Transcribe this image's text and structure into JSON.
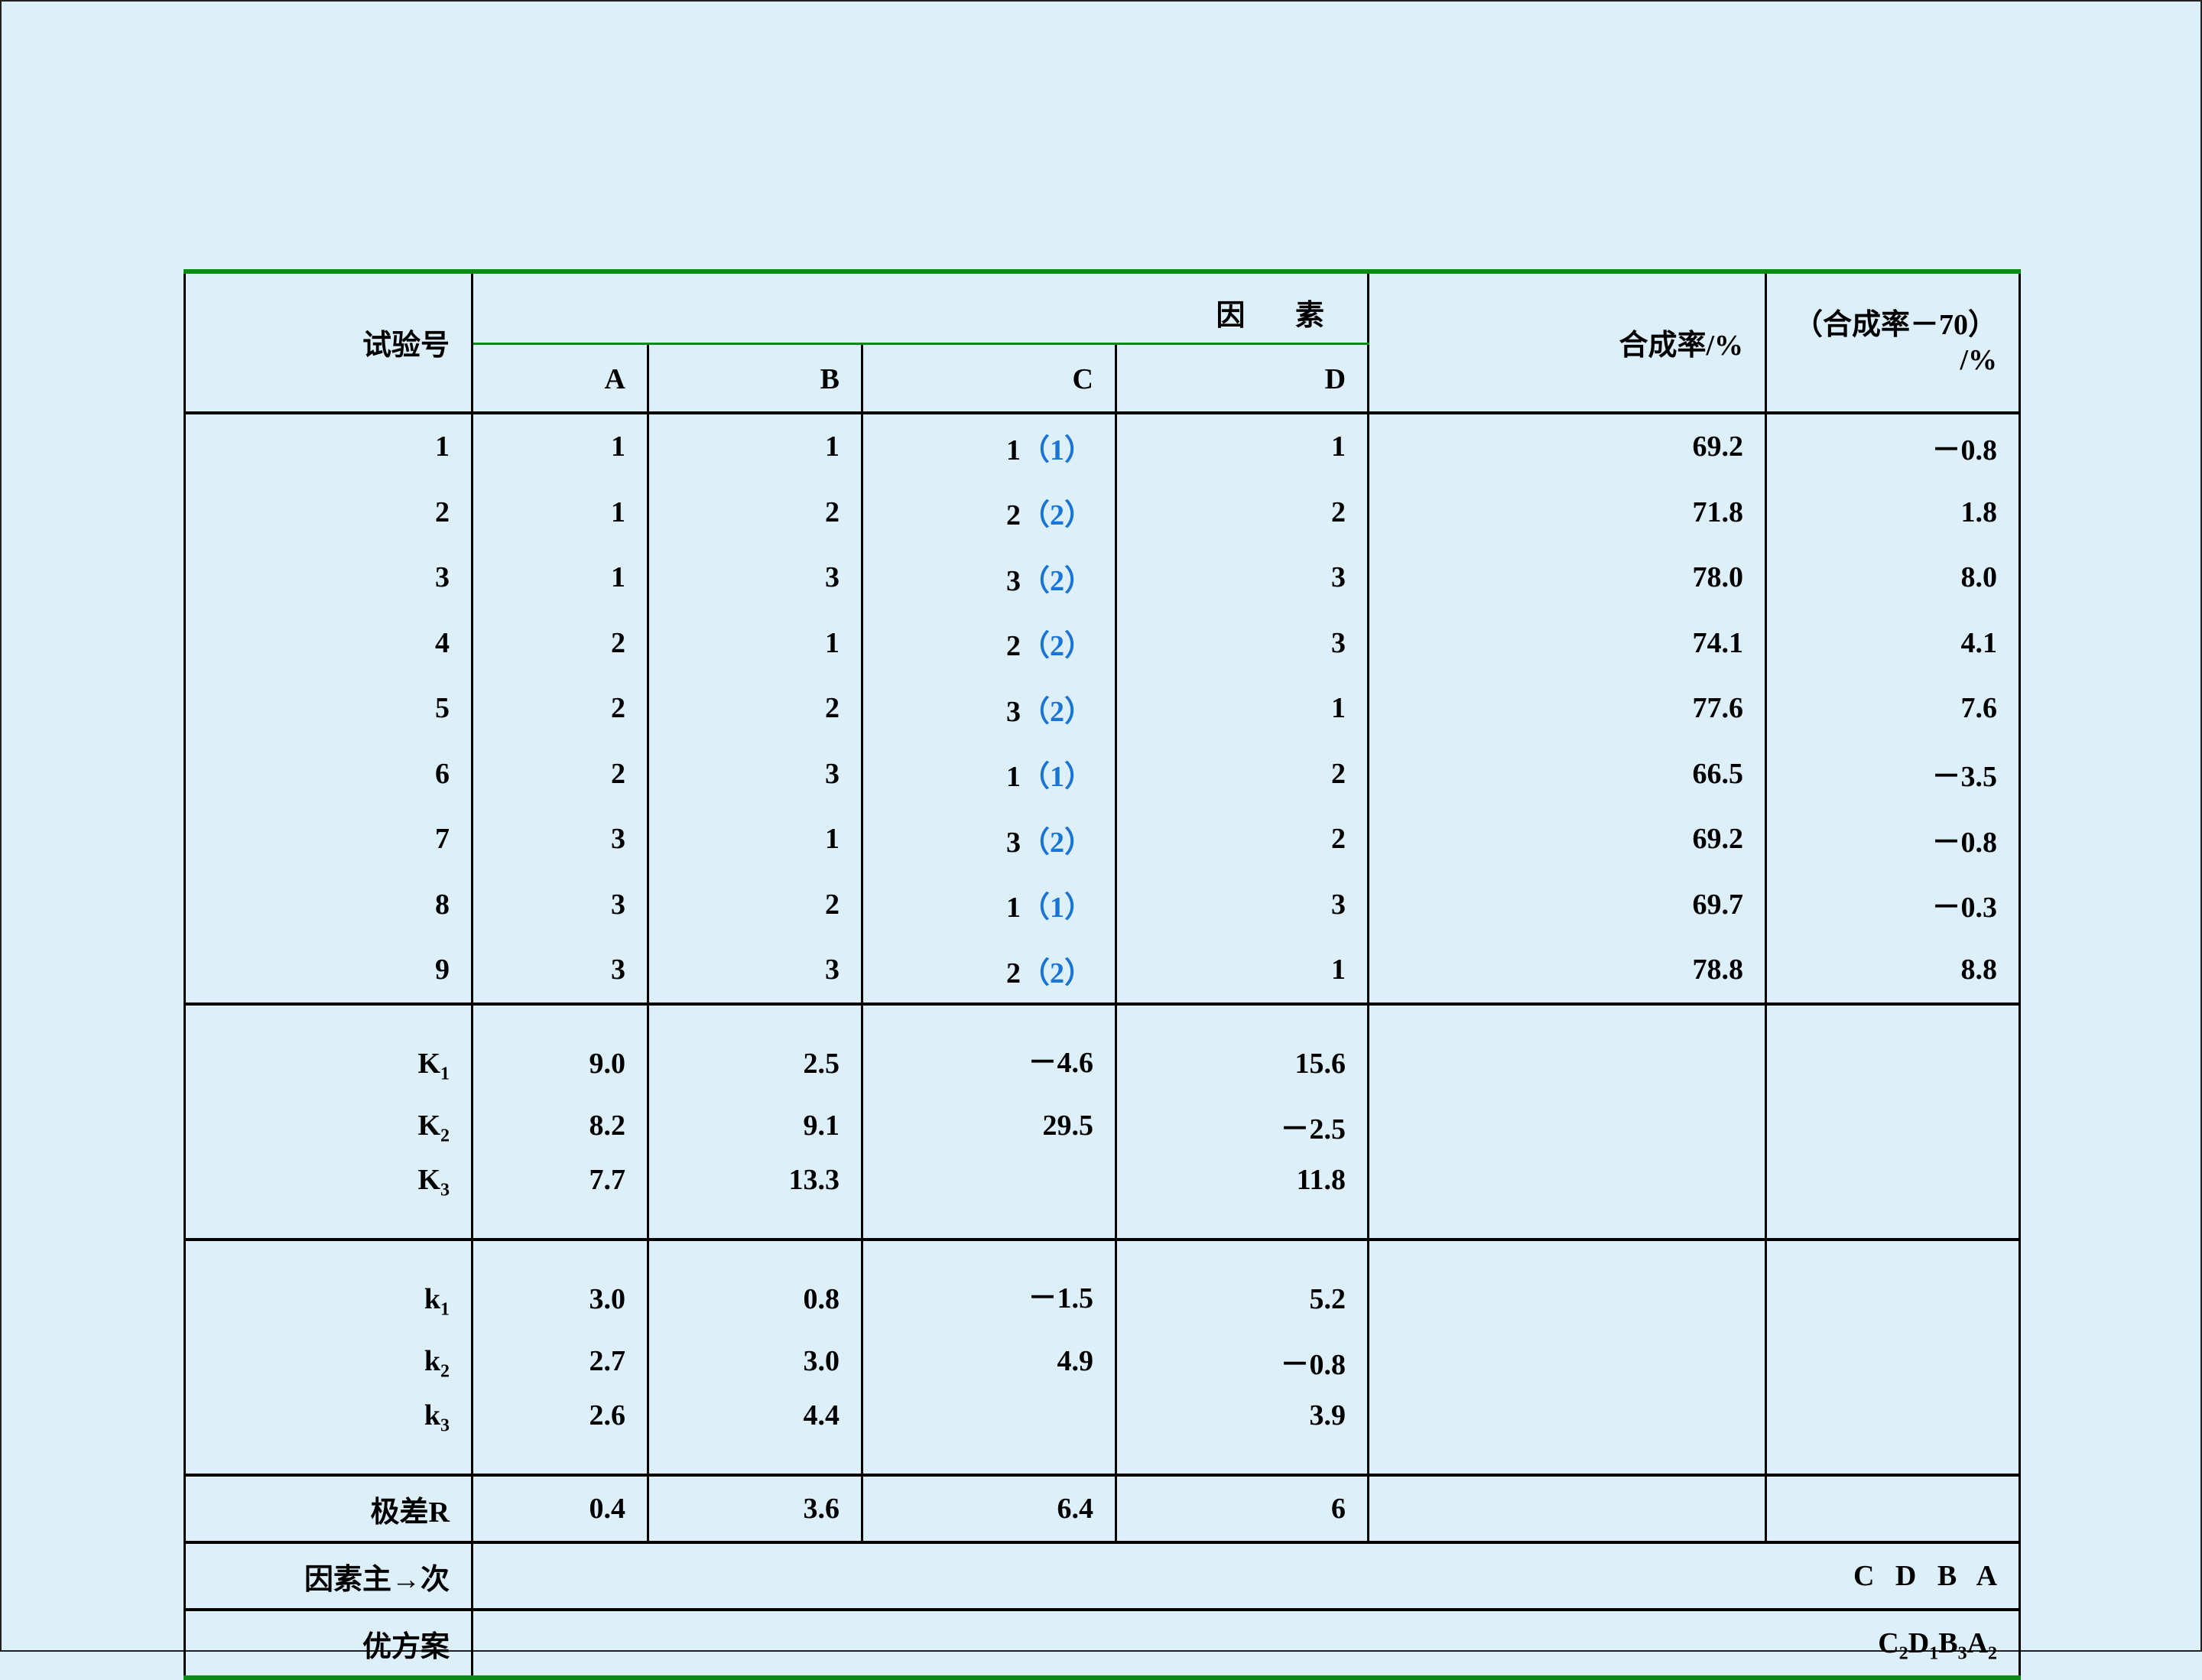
{
  "table": {
    "header": {
      "trial": "试验号",
      "factors": "因 素",
      "columns": [
        "A",
        "B",
        "C",
        "D"
      ],
      "rate": "合成率/%",
      "rate_minus_line1": "（合成率－70）",
      "rate_minus_line2": "/%"
    },
    "rows": [
      {
        "n": "1",
        "A": "1",
        "B": "1",
        "C": "1",
        "C_level": "（1）",
        "D": "1",
        "rate": "69.2",
        "diff": "－0.8"
      },
      {
        "n": "2",
        "A": "1",
        "B": "2",
        "C": "2",
        "C_level": "（2）",
        "D": "2",
        "rate": "71.8",
        "diff": "1.8"
      },
      {
        "n": "3",
        "A": "1",
        "B": "3",
        "C": "3",
        "C_level": "（2）",
        "D": "3",
        "rate": "78.0",
        "diff": "8.0"
      },
      {
        "n": "4",
        "A": "2",
        "B": "1",
        "C": "2",
        "C_level": "（2）",
        "D": "3",
        "rate": "74.1",
        "diff": "4.1"
      },
      {
        "n": "5",
        "A": "2",
        "B": "2",
        "C": "3",
        "C_level": "（2）",
        "D": "1",
        "rate": "77.6",
        "diff": "7.6"
      },
      {
        "n": "6",
        "A": "2",
        "B": "3",
        "C": "1",
        "C_level": "（1）",
        "D": "2",
        "rate": "66.5",
        "diff": "－3.5"
      },
      {
        "n": "7",
        "A": "3",
        "B": "1",
        "C": "3",
        "C_level": "（2）",
        "D": "2",
        "rate": "69.2",
        "diff": "－0.8"
      },
      {
        "n": "8",
        "A": "3",
        "B": "2",
        "C": "1",
        "C_level": "（1）",
        "D": "3",
        "rate": "69.7",
        "diff": "－0.3"
      },
      {
        "n": "9",
        "A": "3",
        "B": "3",
        "C": "2",
        "C_level": "（2）",
        "D": "1",
        "rate": "78.8",
        "diff": "8.8"
      }
    ],
    "K": [
      {
        "label": "K",
        "sub": "1",
        "A": "9.0",
        "B": "2.5",
        "C": "－4.6",
        "D": "15.6"
      },
      {
        "label": "K",
        "sub": "2",
        "A": "8.2",
        "B": "9.1",
        "C": "29.5",
        "D": "－2.5"
      },
      {
        "label": "K",
        "sub": "3",
        "A": "7.7",
        "B": "13.3",
        "C": "",
        "D": "11.8"
      }
    ],
    "k": [
      {
        "label": "k",
        "sub": "1",
        "A": "3.0",
        "B": "0.8",
        "C": "－1.5",
        "D": "5.2"
      },
      {
        "label": "k",
        "sub": "2",
        "A": "2.7",
        "B": "3.0",
        "C": "4.9",
        "D": "－0.8"
      },
      {
        "label": "k",
        "sub": "3",
        "A": "2.6",
        "B": "4.4",
        "C": "",
        "D": "3.9"
      }
    ],
    "range": {
      "label": "极差R",
      "A": "0.4",
      "B": "3.6",
      "C": "6.4",
      "D": "6"
    },
    "order": {
      "label": "因素主→次",
      "value": "C D B A"
    },
    "optimal": {
      "label": "优方案",
      "parts": [
        {
          "letter": "C",
          "sub": "2"
        },
        {
          "letter": "D",
          "sub": "1"
        },
        {
          "letter": "B",
          "sub": "3"
        },
        {
          "letter": "A",
          "sub": "2"
        }
      ]
    }
  }
}
